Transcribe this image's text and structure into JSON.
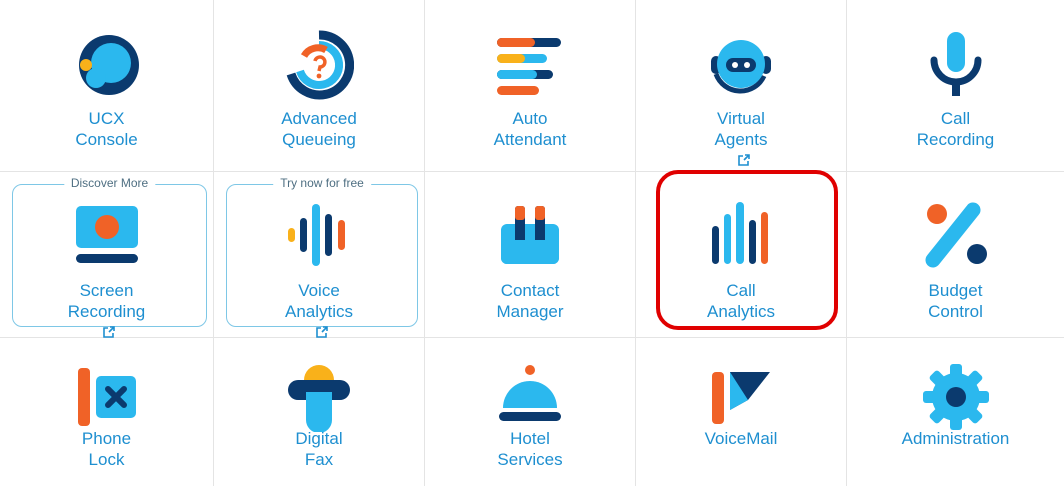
{
  "tiles": [
    {
      "id": "ucx-console",
      "line1": "UCX",
      "line2": "Console",
      "icon": "ucx-console-icon"
    },
    {
      "id": "advanced-queueing",
      "line1": "Advanced",
      "line2": "Queueing",
      "icon": "advanced-queueing-icon"
    },
    {
      "id": "auto-attendant",
      "line1": "Auto",
      "line2": "Attendant",
      "icon": "auto-attendant-icon"
    },
    {
      "id": "virtual-agents",
      "line1": "Virtual",
      "line2": "Agents",
      "icon": "virtual-agents-icon",
      "external": true
    },
    {
      "id": "call-recording",
      "line1": "Call",
      "line2": "Recording",
      "icon": "call-recording-icon"
    },
    {
      "id": "screen-recording",
      "line1": "Screen",
      "line2": "Recording",
      "icon": "screen-recording-icon",
      "external": true,
      "promo": "Discover More"
    },
    {
      "id": "voice-analytics",
      "line1": "Voice",
      "line2": "Analytics",
      "icon": "voice-analytics-icon",
      "external": true,
      "promo": "Try now for free"
    },
    {
      "id": "contact-manager",
      "line1": "Contact",
      "line2": "Manager",
      "icon": "contact-manager-icon"
    },
    {
      "id": "call-analytics",
      "line1": "Call",
      "line2": "Analytics",
      "icon": "call-analytics-icon",
      "highlighted": true
    },
    {
      "id": "budget-control",
      "line1": "Budget",
      "line2": "Control",
      "icon": "budget-control-icon"
    },
    {
      "id": "phone-lock",
      "line1": "Phone",
      "line2": "Lock",
      "icon": "phone-lock-icon"
    },
    {
      "id": "digital-fax",
      "line1": "Digital",
      "line2": "Fax",
      "icon": "digital-fax-icon"
    },
    {
      "id": "hotel-services",
      "line1": "Hotel",
      "line2": "Services",
      "icon": "hotel-services-icon"
    },
    {
      "id": "voicemail",
      "line1": "VoiceMail",
      "line2": "",
      "icon": "voicemail-icon"
    },
    {
      "id": "administration",
      "line1": "Administration",
      "line2": "",
      "icon": "administration-icon"
    }
  ],
  "colors": {
    "label": "#1e8fd0",
    "navy": "#0b3a6e",
    "cyan": "#2bb8ee",
    "orange": "#f06227",
    "yellow": "#f9b11a",
    "highlight": "#e00000"
  }
}
